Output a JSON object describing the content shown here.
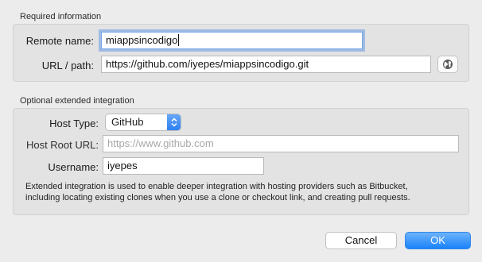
{
  "required": {
    "section_title": "Required information",
    "remote_name_label": "Remote name:",
    "remote_name_value": "miappsincodigo",
    "url_label": "URL / path:",
    "url_value": "https://github.com/iyepes/miappsincodigo.git"
  },
  "optional": {
    "section_title": "Optional extended integration",
    "host_type_label": "Host Type:",
    "host_type_value": "GitHub",
    "host_root_label": "Host Root URL:",
    "host_root_placeholder": "https://www.github.com",
    "username_label": "Username:",
    "username_value": "iyepes",
    "help_text_line1": "Extended integration is used to enable deeper integration with hosting providers such as Bitbucket,",
    "help_text_line2": "including locating existing clones when you use a clone or checkout link, and creating pull requests."
  },
  "buttons": {
    "cancel_label": "Cancel",
    "ok_label": "OK"
  },
  "icons": {
    "browse": "globe-icon",
    "popup": "up-down-chevron-icon"
  },
  "colors": {
    "accent": "#1a82fb",
    "focus_ring": "#689be4"
  }
}
